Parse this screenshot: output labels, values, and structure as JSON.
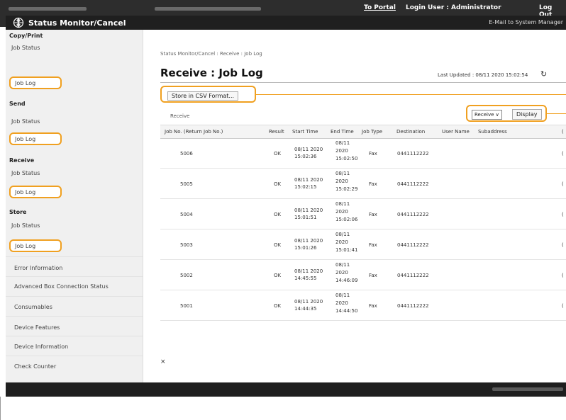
{
  "topbar": {
    "portal_link": "To Portal",
    "login_label": "Login User :  Administrator",
    "logout_link": "Log Out"
  },
  "titlebar": {
    "title": "Status Monitor/Cancel",
    "mail_link": "E-Mail to System Manager"
  },
  "sidebar": {
    "sections": [
      {
        "title": "Copy/Print",
        "items": [
          {
            "label": "Job Status"
          },
          {
            "label": "Job Log"
          }
        ]
      },
      {
        "title": "Send",
        "items": [
          {
            "label": "Job Status"
          },
          {
            "label": "Job Log"
          }
        ]
      },
      {
        "title": "Receive",
        "items": [
          {
            "label": "Job Status"
          },
          {
            "label": "Job Log"
          }
        ]
      },
      {
        "title": "Store",
        "items": [
          {
            "label": "Job Status"
          },
          {
            "label": "Job Log"
          }
        ]
      }
    ],
    "other_items": [
      {
        "label": "Error Information"
      },
      {
        "label": "Advanced Box Connection Status"
      },
      {
        "label": "Consumables"
      },
      {
        "label": "Device Features"
      },
      {
        "label": "Device Information"
      },
      {
        "label": "Check Counter"
      }
    ]
  },
  "main": {
    "breadcrumb": "Status Monitor/Cancel : Receive : Job Log",
    "heading": "Receive : Job Log",
    "last_updated": "Last Updated : 08/11 2020 15:02:54",
    "csv_button": "Store in CSV Format...",
    "box_label": "Receive",
    "filter_select": "Receive",
    "display_button": "Display",
    "columns": [
      "Job No. (Return Job No.)",
      "Result",
      "Start Time",
      "End Time",
      "Job Type",
      "Destination",
      "User Name",
      "Subaddress",
      "("
    ],
    "rows": [
      {
        "job_no": "5006",
        "result": "OK",
        "start_1": "08/11 2020",
        "start_2": "15:02:36",
        "end_1": "08/11",
        "end_2": "2020",
        "end_3": "15:02:50",
        "type": "Fax",
        "dest": "0441112222",
        "trail": "("
      },
      {
        "job_no": "5005",
        "result": "OK",
        "start_1": "08/11 2020",
        "start_2": "15:02:15",
        "end_1": "08/11",
        "end_2": "2020",
        "end_3": "15:02:29",
        "type": "Fax",
        "dest": "0441112222",
        "trail": "("
      },
      {
        "job_no": "5004",
        "result": "OK",
        "start_1": "08/11 2020",
        "start_2": "15:01:51",
        "end_1": "08/11",
        "end_2": "2020",
        "end_3": "15:02:06",
        "type": "Fax",
        "dest": "0441112222",
        "trail": "("
      },
      {
        "job_no": "5003",
        "result": "OK",
        "start_1": "08/11 2020",
        "start_2": "15:01:26",
        "end_1": "08/11",
        "end_2": "2020",
        "end_3": "15:01:41",
        "type": "Fax",
        "dest": "0441112222",
        "trail": "("
      },
      {
        "job_no": "5002",
        "result": "OK",
        "start_1": "08/11 2020",
        "start_2": "14:45:55",
        "end_1": "08/11",
        "end_2": "2020",
        "end_3": "14:46:09",
        "type": "Fax",
        "dest": "0441112222",
        "trail": "("
      },
      {
        "job_no": "5001",
        "result": "OK",
        "start_1": "08/11 2020",
        "start_2": "14:44:35",
        "end_1": "08/11",
        "end_2": "2020",
        "end_3": "14:44:50",
        "type": "Fax",
        "dest": "0441112222",
        "trail": "("
      }
    ]
  },
  "colors": {
    "highlight": "#f0a020",
    "header_bg": "#2d2d2d",
    "sidebar_bg": "#f0f0f0"
  },
  "icons": {
    "brand": "globe-icon",
    "refresh": "refresh-icon",
    "scroll_top": "scroll-top-icon"
  }
}
